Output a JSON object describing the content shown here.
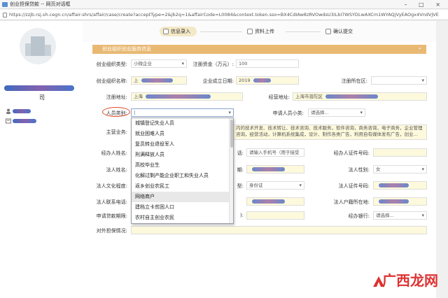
{
  "window": {
    "title": "创业担保贷款 -- 网页对话框",
    "controls": "– □ ×"
  },
  "url": "https://zzjb.rsj.sh.cegn.cn/affair-shrs/affair/case/create?acceptType=2&jb2q=1&affairCode=L0084&context.token.sso=BX4CdIAw8zRVOwdsU3iLbI7WSYDLwAXCm1WYAQjVyEAOgx4VndVJVE",
  "sidebar": {
    "name_suffix": "司"
  },
  "steps": [
    {
      "label": "信息录入"
    },
    {
      "label": "资料上传"
    },
    {
      "label": "确认提交"
    }
  ],
  "section": {
    "title": "创业组织创业服务信息"
  },
  "form": {
    "org_type": {
      "label": "创业组织类型:",
      "value": "小微企业"
    },
    "capital": {
      "label": "注册资金（万元）:",
      "value": "100"
    },
    "org_name": {
      "label": "创业组织名称:",
      "value": "上"
    },
    "found_date": {
      "label": "企业成立日期:",
      "value": "2019"
    },
    "reg_district": {
      "label": "注册所在区:",
      "value": ""
    },
    "reg_address": {
      "label": "注册地址:",
      "value": "上海"
    },
    "biz_address": {
      "label": "经营地址:",
      "value": "上海市普陀区"
    },
    "person_type": {
      "label": "人员类别:",
      "value": "|"
    },
    "applicant_subtype": {
      "label": "申请人员小类:",
      "placeholder": "请选择..."
    },
    "main_business": {
      "label": "主营业务:",
      "value": "内的技术开发、技术转让、技术咨询、技术服务，软件咨询，商务咨询，电子商务，企业管理咨询，经营活动，计算机系统集成，设计、制作各类广告，利用自有媒体发布广告，创业…"
    },
    "handler_name": {
      "label": "经办人姓名:"
    },
    "handler_phone": {
      "label": "话:",
      "placeholder": "请输入手机号（用于接受"
    },
    "handler_id": {
      "label": "经办人证件号码:"
    },
    "legal_name": {
      "label": "法人姓名:"
    },
    "legal_id_type_lbl": {
      "label": "期:"
    },
    "legal_gender": {
      "label": "法人性别:",
      "value": "女"
    },
    "legal_edu": {
      "label": "法人文化程度:"
    },
    "legal_cert_type": {
      "label": "型:",
      "value": "身份证"
    },
    "legal_cert_no": {
      "label": "法人证件号码:"
    },
    "legal_phone": {
      "label": "法人联系电话:"
    },
    "legal_hukou": {
      "label": "法人户籍所在地:"
    },
    "loan_term": {
      "label": "申请贷款期限:"
    },
    "loan_term_b": {
      "label": "):"
    },
    "bank": {
      "label": "经办银行:",
      "placeholder": "请选择..."
    },
    "guarantee": {
      "label": "对外担保情况:"
    }
  },
  "dropdown": {
    "items": [
      "城镇登记失业人员",
      "就业困难人员",
      "复员转业退役军人",
      "刑满释放人员",
      "高校毕业生",
      "化解过剩产能企业职工和失业人员",
      "返乡创业农民工",
      "网络商户",
      "建档立卡贫困人口",
      "农村自主创业农民"
    ],
    "highlighted_index": 7
  },
  "watermark": {
    "text": "广西龙网"
  },
  "colors": {
    "accent": "#e9b974",
    "step_active": "#f3e8c7",
    "highlight_circle": "#e04a2a",
    "field_yellow": "#fdf9dc"
  }
}
